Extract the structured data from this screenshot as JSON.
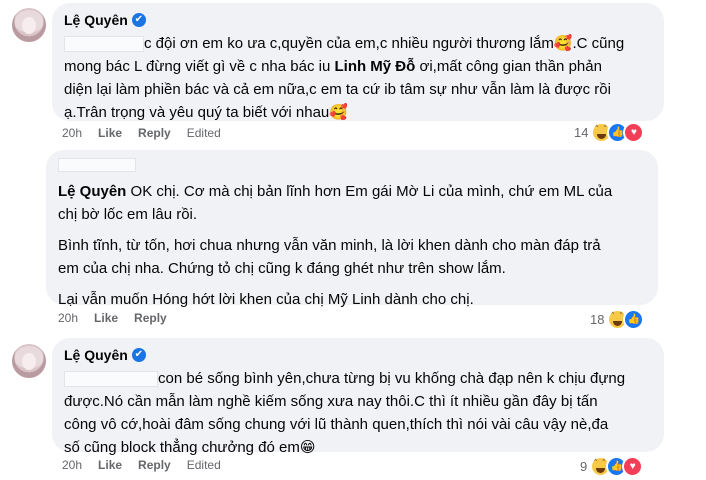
{
  "comments": [
    {
      "author": "Lệ Quyên",
      "verified_mark": "✔",
      "text_lines": [
        "c đội ơn em ko ưa c,quyền của em,c nhiều người thương lắm🥰.C cũng",
        "mong bác L đừng viết gì về c nha bác iu ",
        "Linh Mỹ Đỗ",
        " ơi,mất công gian thần phản",
        "diện lại làm phiền bác và cả em nữa,c em ta cứ ib tâm sự như vẫn làm là được rồi",
        "ạ.Trân trọng và yêu quý ta biết với nhau🥰"
      ],
      "time": "20h",
      "like": "Like",
      "reply": "Reply",
      "edited": "Edited",
      "reaction_count": "14"
    },
    {
      "author": "Lệ Quyên",
      "first_line": " OK chị. Cơ mà chị bản lĩnh hơn Em gái Mờ Li của mình, chứ em ML của",
      "second_line": "chị bờ lốc em lâu rồi.",
      "para2_line1": "Bình tĩnh, từ tốn, hơi chua nhưng vẫn văn minh, là lời khen dành cho màn đáp trả",
      "para2_line2": "em của chị nha. Chứng tỏ chị cũng k đáng ghét như trên show lắm.",
      "para3": "Lại vẫn muốn Hóng hớt lời khen của chị Mỹ Linh dành cho chị.",
      "time": "20h",
      "like": "Like",
      "reply": "Reply",
      "reaction_count": "18"
    },
    {
      "author": "Lệ Quyên",
      "verified_mark": "✔",
      "line1": "con bé sống bình yên,chưa từng bị vu khống chà đạp nên k chịu đựng",
      "line2": "được.Nó cần mẫn làm nghề kiếm sống xưa nay thôi.C thì ít nhiều gần đây bị tấn",
      "line3": "công vô cớ,hoài đâm sống chung với lũ thành quen,thích thì nói vài câu vậy nè,đa",
      "line4": "số cũng block thẳng chưởng đó em😁",
      "time": "20h",
      "like": "Like",
      "reply": "Reply",
      "edited": "Edited",
      "reaction_count": "9"
    }
  ],
  "reaction_icons": [
    "haha-icon",
    "like-icon",
    "love-icon"
  ],
  "colors": {
    "bubble": "#f0f2f5",
    "meta": "#65676b",
    "like_blue": "#1877f2",
    "love_red": "#f33e58",
    "haha_yellow": "#f7c948",
    "verified_blue": "#1b74e4"
  }
}
